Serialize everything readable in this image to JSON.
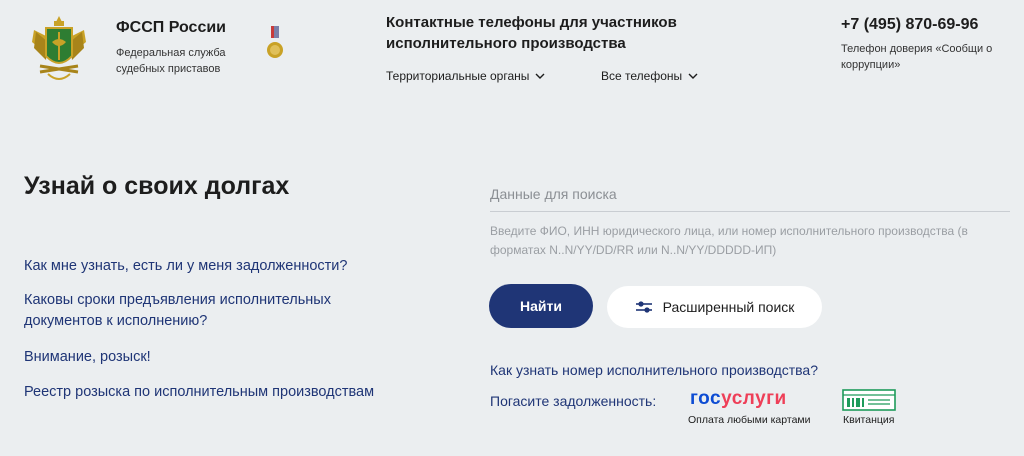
{
  "header": {
    "org_name": "ФССП России",
    "org_sub": "Федеральная служба судебных приставов",
    "contacts_title": "Контактные телефоны для участников исполнительного производства",
    "dropdowns": [
      "Территориальные органы",
      "Все телефоны"
    ],
    "phone": "+7 (495) 870-69-96",
    "trust_line": "Телефон доверия «Сообщи о коррупции»"
  },
  "main": {
    "title": "Узнай о своих долгах",
    "faq": [
      "Как мне узнать, есть ли у меня задолженности?",
      "Каковы сроки предъявления исполнительных документов к исполнению?",
      "Внимание, розыск!",
      "Реестр розыска по исполнительным производствам"
    ]
  },
  "search": {
    "placeholder": "Данные для поиска",
    "hint": "Введите ФИО, ИНН юридического лица, или номер исполнительного производства (в форматах N..N/YY/DD/RR или N..N/YY/DDDDD-ИП)",
    "find_label": "Найти",
    "advanced_label": "Расширенный поиск",
    "ip_link": "Как узнать номер исполнительного производства?",
    "pay_label": "Погасите задолженность:",
    "gos_part1": "гос",
    "gos_part2": "услуги",
    "gos_caption": "Оплата любыми картами",
    "receipt_caption": "Квитанция"
  },
  "colors": {
    "accent": "#1f3576",
    "gos_blue": "#0d4cd3",
    "gos_red": "#ee3f58",
    "receipt_green": "#1e9b5b",
    "background": "#ebeef0"
  },
  "icons": [
    "emblem-icon",
    "medal-icon",
    "chevron-down-icon",
    "filter-sliders-icon",
    "receipt-icon"
  ]
}
